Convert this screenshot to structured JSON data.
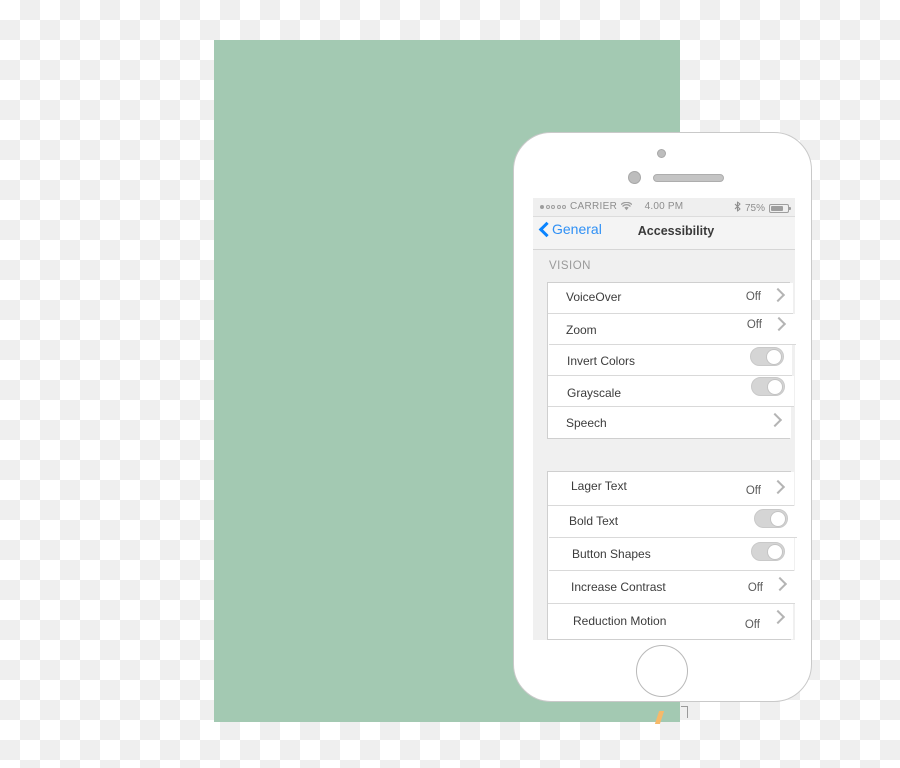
{
  "statusbar": {
    "carrier": "CARRIER",
    "signal_dots_total": 5,
    "signal_dots_filled": 1,
    "wifi_icon": "wifi-icon",
    "time": "4.00 PM",
    "bluetooth_icon": "bluetooth-icon",
    "battery_percent": "75%",
    "battery_level": 75
  },
  "navbar": {
    "back_label": "General",
    "back_icon": "chevron-left-icon",
    "title": "Accessibility"
  },
  "sections": [
    {
      "header": "VISION",
      "rows": [
        {
          "label": "VoiceOver",
          "value": "Off",
          "control": "chevron"
        },
        {
          "label": "Zoom",
          "value": "Off",
          "control": "chevron"
        },
        {
          "label": "Invert Colors",
          "value": "",
          "control": "toggle",
          "toggle_state": "off"
        },
        {
          "label": "Grayscale",
          "value": "",
          "control": "toggle",
          "toggle_state": "off"
        },
        {
          "label": "Speech",
          "value": "",
          "control": "chevron"
        }
      ]
    },
    {
      "header": "",
      "rows": [
        {
          "label": "Lager Text",
          "value": "Off",
          "control": "chevron"
        },
        {
          "label": "Bold Text",
          "value": "",
          "control": "toggle",
          "toggle_state": "off"
        },
        {
          "label": "Button Shapes",
          "value": "",
          "control": "toggle",
          "toggle_state": "off"
        },
        {
          "label": "Increase Contrast",
          "value": "Off",
          "control": "chevron"
        },
        {
          "label": "Reduction Motion",
          "value": "Off",
          "control": "chevron"
        }
      ]
    }
  ],
  "device": {
    "camera_icon": "camera-dot-icon",
    "sensor_icon": "proximity-sensor-icon",
    "speaker_icon": "earpiece-speaker-icon",
    "home_button": "home-button"
  },
  "colors": {
    "canvas_green": "#a3c9b2",
    "accent_blue": "#2f90f5",
    "chevron_grey": "#b4b4b4",
    "toggle_off": "#d5d5d5"
  }
}
